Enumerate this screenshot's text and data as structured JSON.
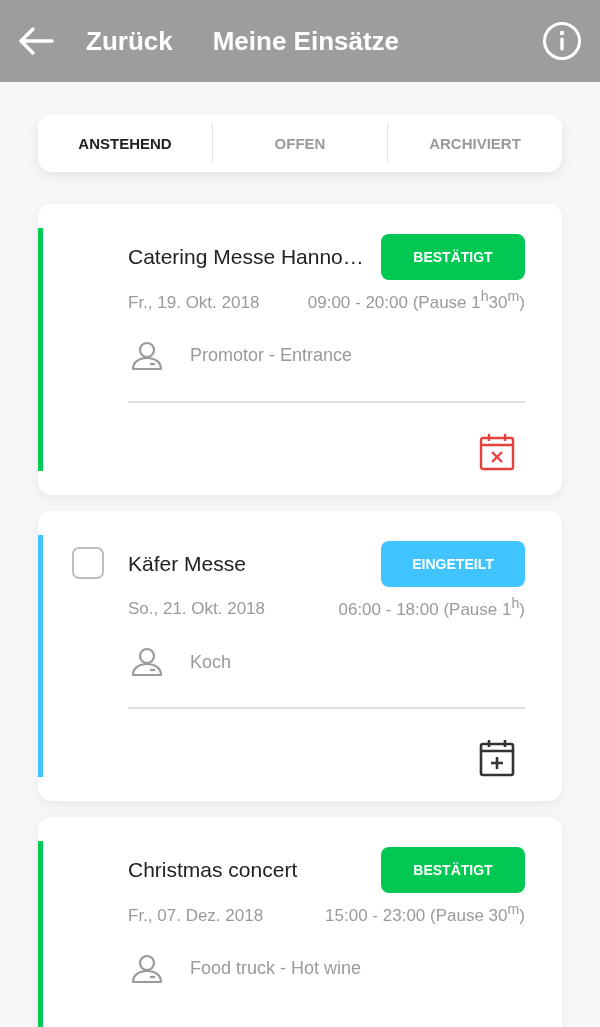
{
  "header": {
    "back_label": "Zurück",
    "title": "Meine Einsätze"
  },
  "tabs": [
    {
      "label": "ANSTEHEND",
      "selected": true
    },
    {
      "label": "OFFEN",
      "selected": false
    },
    {
      "label": "ARCHIVIERT",
      "selected": false
    }
  ],
  "assignments": [
    {
      "title": "Catering Messe Hanno…",
      "status": "BESTÄTIGT",
      "color": "#00c853",
      "date": "Fr., 19. Okt. 2018",
      "time": "09:00 - 20:00 (Pause 1$^{h}$30$^{m}$)",
      "role": "Promotor - Entrance",
      "action": {
        "kind": "remove"
      }
    },
    {
      "title": "Käfer Messe",
      "status": "EINGETEILT",
      "color": "#40c4ff",
      "checked": false,
      "date": "So., 21. Okt. 2018",
      "time": "06:00 - 18:00 (Pause 1$^{h}$)",
      "role": "Koch",
      "action": {
        "kind": "add"
      }
    },
    {
      "title": "Christmas concert",
      "status": "BESTÄTIGT",
      "color": "#00c853",
      "date": "Fr., 07. Dez. 2018",
      "time": "15:00 - 23:00 (Pause 30$^{m}$)",
      "role": "Food truck - Hot wine"
    }
  ]
}
